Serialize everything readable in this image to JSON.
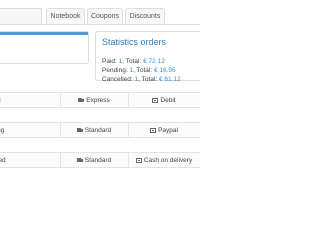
{
  "tabs": [
    {
      "label": "Notebook"
    },
    {
      "label": "Coupons"
    },
    {
      "label": "Discounts"
    }
  ],
  "colors": {
    "accent": "#4a9fd8",
    "title": "#2f7fbf",
    "link": "#3a8fd0"
  },
  "statistics": {
    "title": "Statistics orders",
    "lines": [
      {
        "label": "Paid:",
        "count": "1",
        "total_label": "Total:",
        "total": "€ 72.12"
      },
      {
        "label": "Pending:",
        "count": "1",
        "total_label": "Total:",
        "total": "€ 16.95"
      },
      {
        "label": "Cancelled:",
        "count": "1",
        "total_label": "Total:",
        "total": "€ 61.12"
      }
    ]
  },
  "orders": [
    {
      "status_partial": "d",
      "shipping": "Express",
      "payment": "Debit",
      "shipping_icon": "truck-icon",
      "payment_icon": "money-icon"
    },
    {
      "status_partial": "ng",
      "shipping": "Standard",
      "payment": "Paypal",
      "shipping_icon": "truck-icon",
      "payment_icon": "money-icon"
    },
    {
      "status_partial": "led",
      "shipping": "Standard",
      "payment": "Cash on delivery",
      "shipping_icon": "truck-icon",
      "payment_icon": "money-icon"
    }
  ]
}
